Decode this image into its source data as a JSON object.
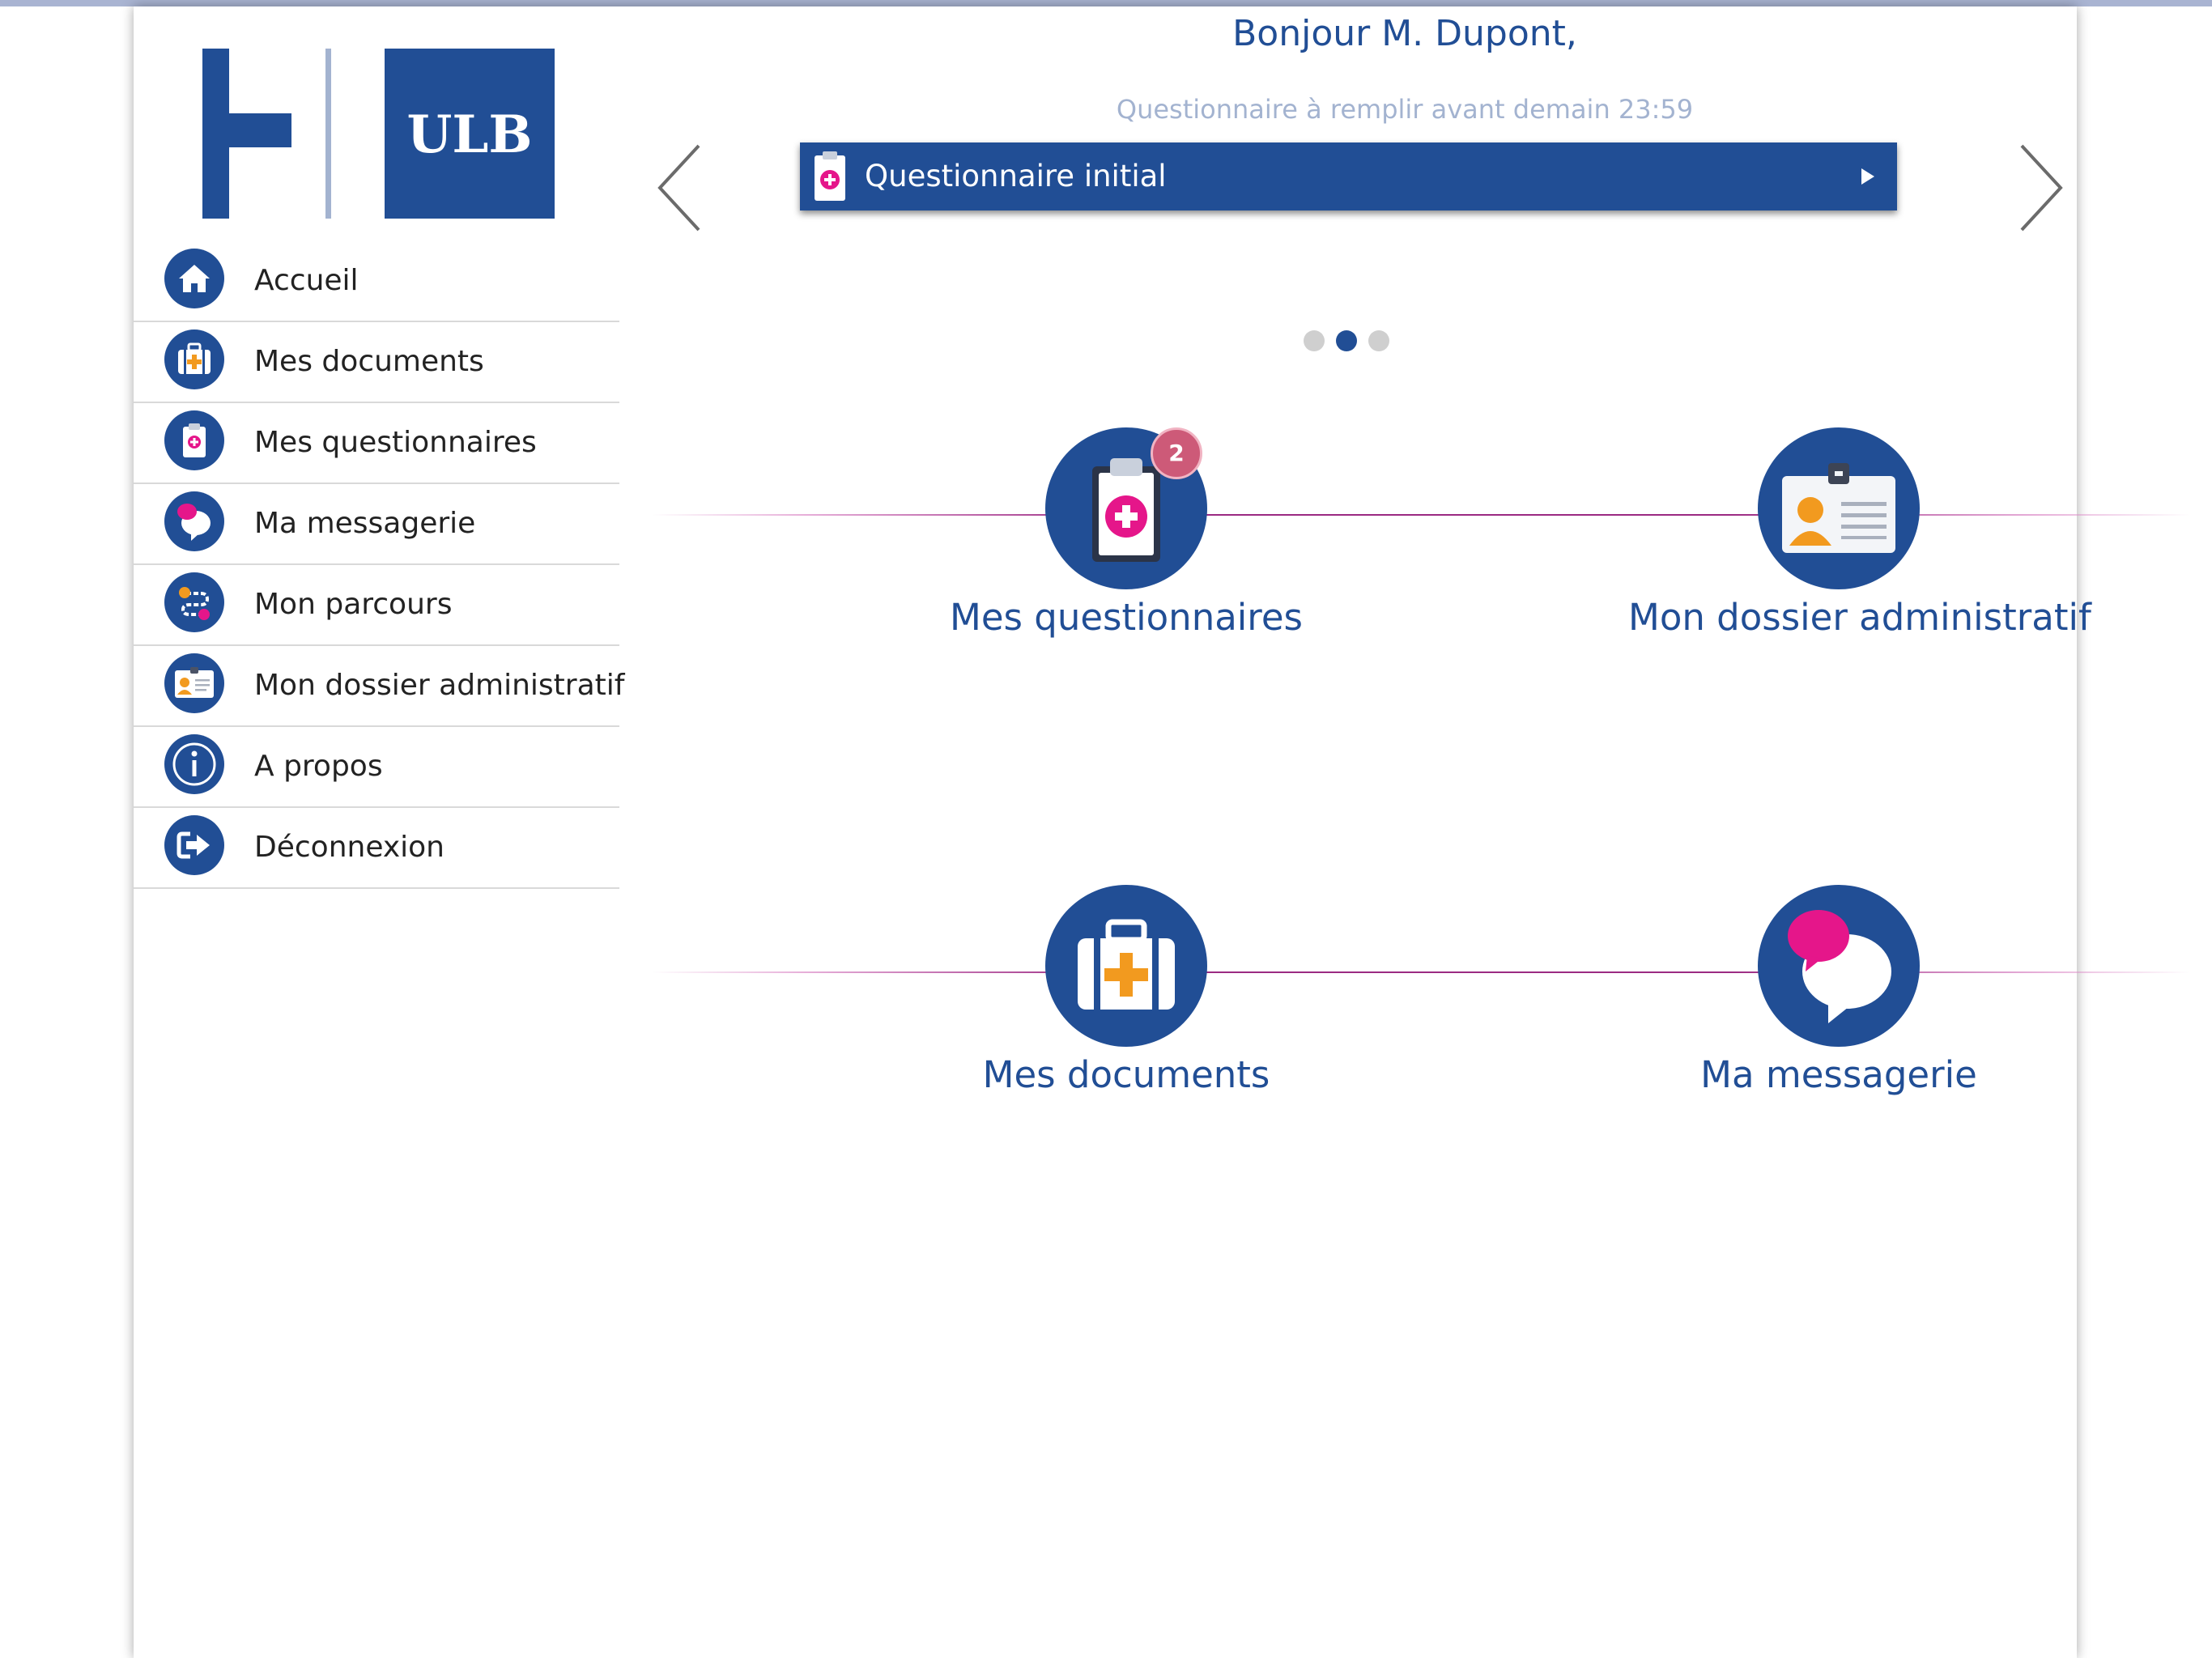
{
  "header": {
    "greeting": "Bonjour M. Dupont,",
    "subtitle": "Questionnaire à remplir avant demain 23:59"
  },
  "logo": {
    "text": "ULB"
  },
  "sidebar": {
    "items": [
      {
        "label": "Accueil",
        "icon": "home-icon"
      },
      {
        "label": "Mes documents",
        "icon": "medical-case-icon"
      },
      {
        "label": "Mes questionnaires",
        "icon": "clipboard-icon"
      },
      {
        "label": "Ma messagerie",
        "icon": "chat-bubble-icon"
      },
      {
        "label": "Mon parcours",
        "icon": "route-icon"
      },
      {
        "label": "Mon dossier administratif",
        "icon": "id-card-icon"
      },
      {
        "label": "A propos",
        "icon": "info-icon"
      },
      {
        "label": "Déconnexion",
        "icon": "logout-icon"
      }
    ]
  },
  "carousel": {
    "item_label": "Questionnaire initial",
    "active_page": 2,
    "page_count": 3
  },
  "tiles": [
    {
      "label": "Mes questionnaires",
      "icon": "clipboard-icon",
      "badge": "2"
    },
    {
      "label": "Mon dossier administratif",
      "icon": "id-card-icon"
    },
    {
      "label": "Mes documents",
      "icon": "medical-case-icon"
    },
    {
      "label": "Ma messagerie",
      "icon": "chat-bubble-icon"
    }
  ],
  "colors": {
    "primary": "#214e95",
    "accent_pink": "#e5168a",
    "accent_orange": "#f29a1f",
    "muted_text": "#a3b3d0",
    "badge": "#cd5a78"
  }
}
